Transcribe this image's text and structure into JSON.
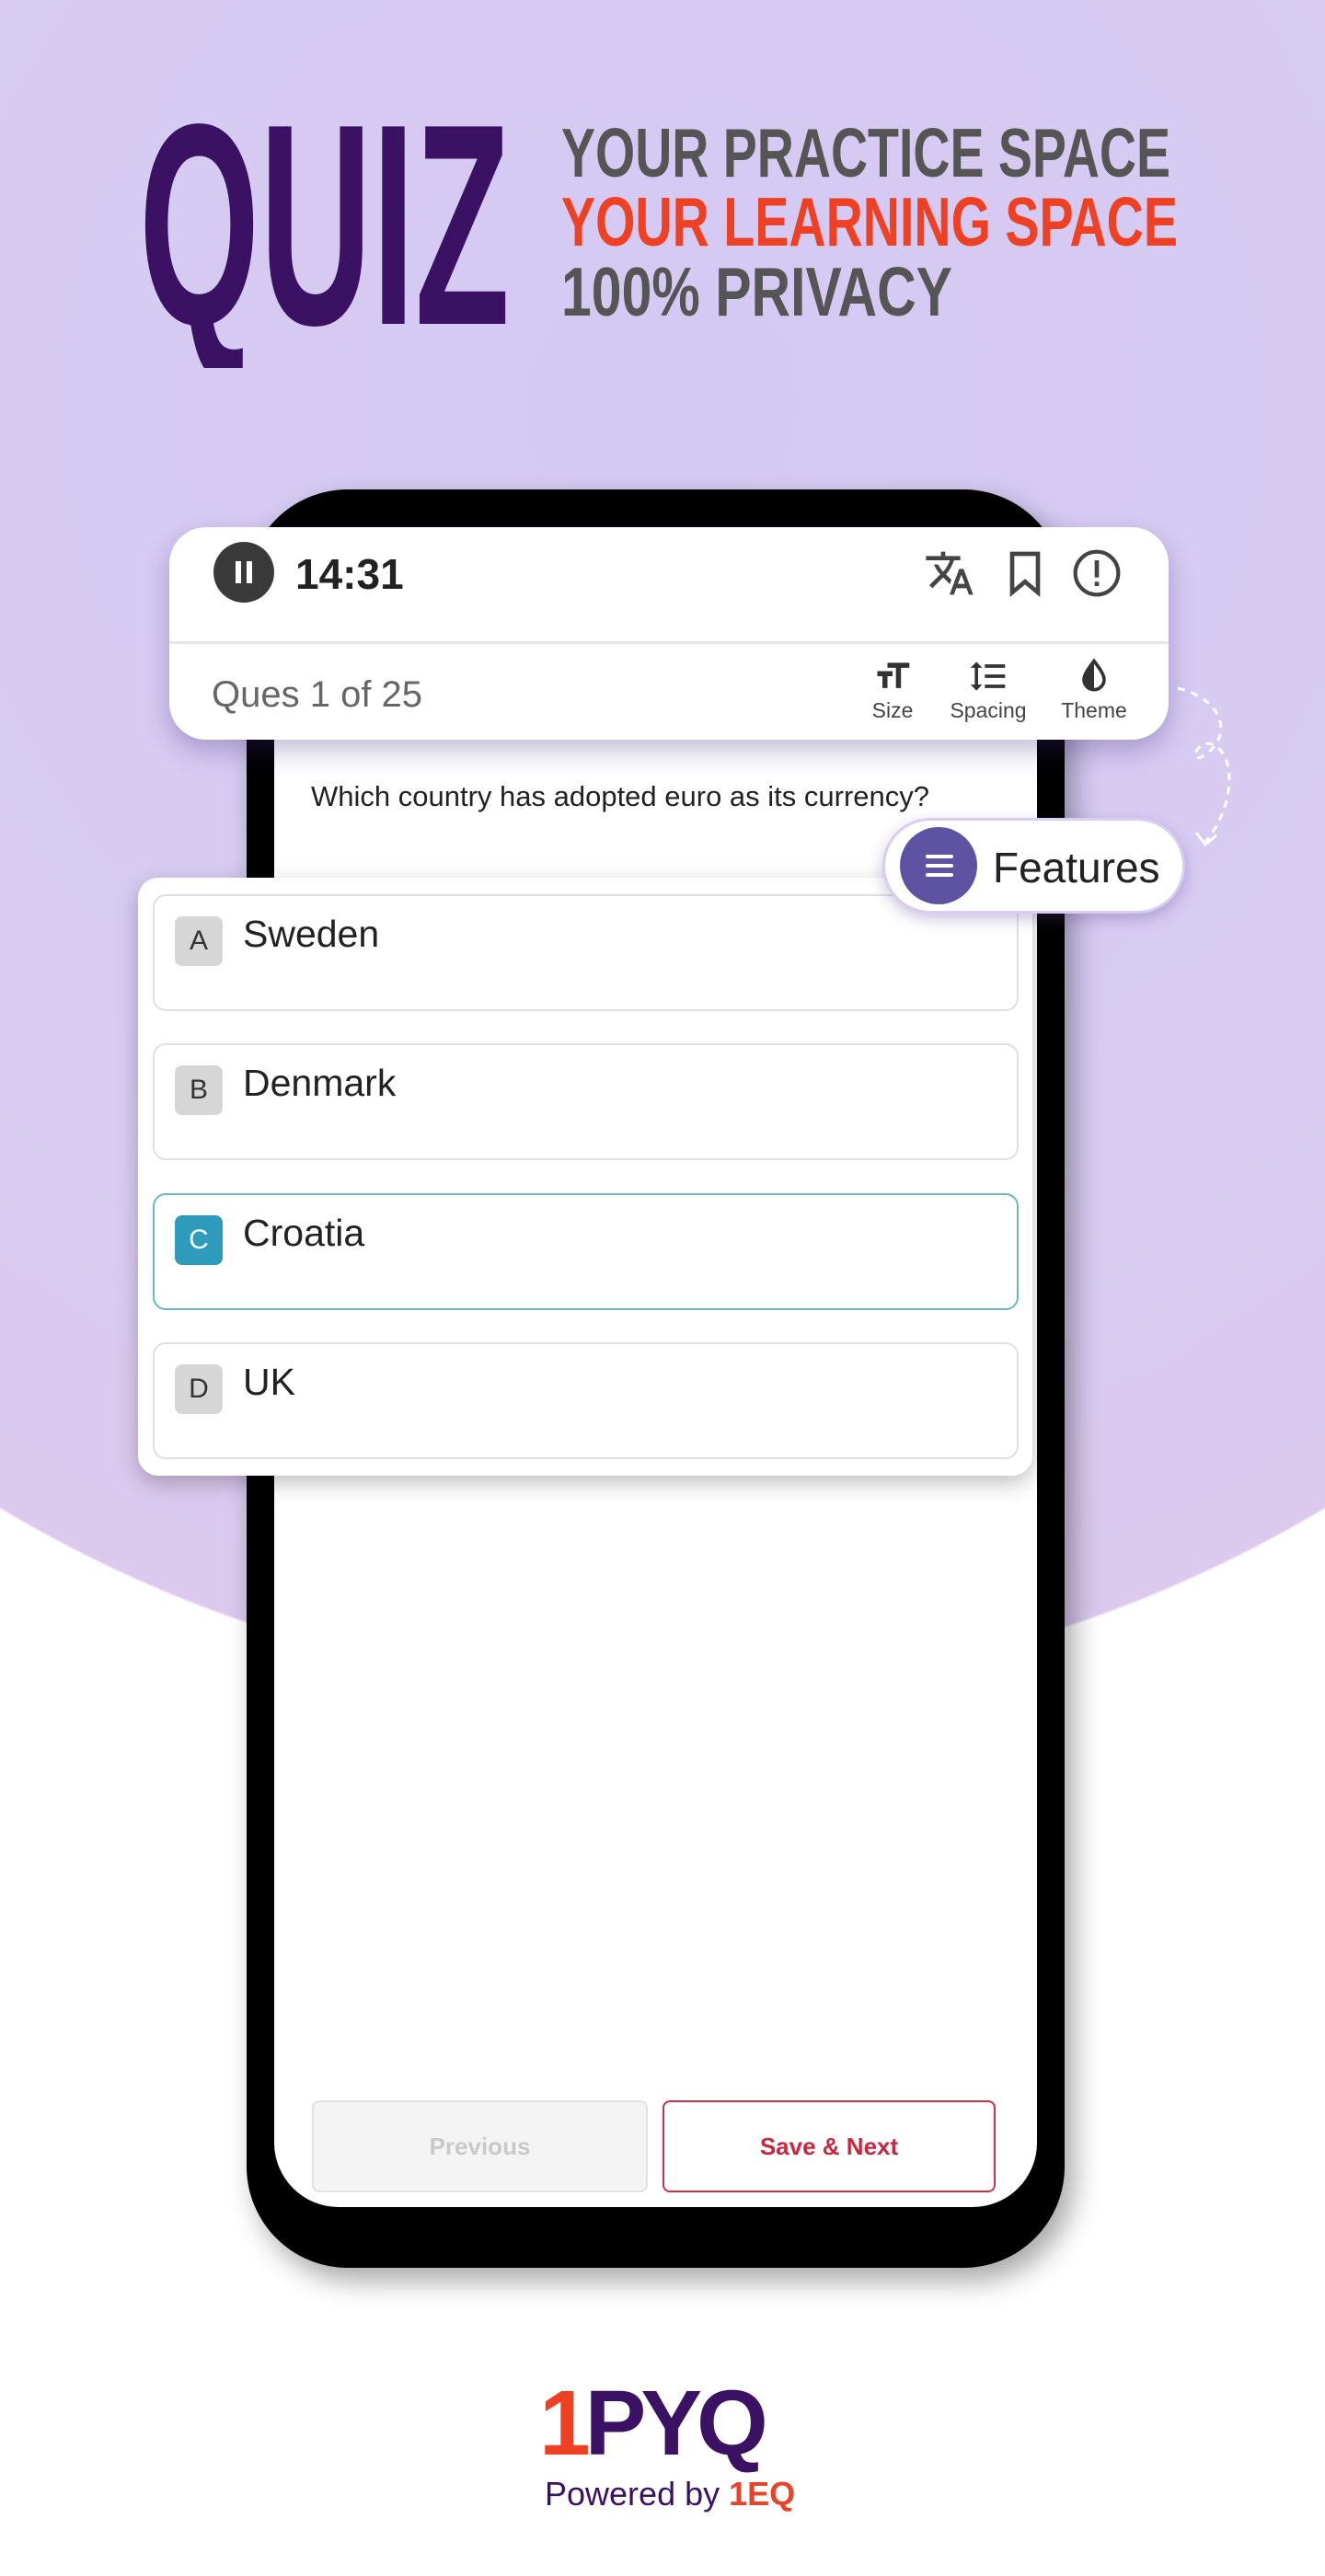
{
  "hero": {
    "title": "QUIZ",
    "taglines": [
      "YOUR PRACTICE SPACE",
      "YOUR LEARNING SPACE",
      "100% PRIVACY"
    ],
    "colors": {
      "title": "#3b1163",
      "tagline": "#555555",
      "accent": "#ee4123",
      "background": "#d4c9f3"
    }
  },
  "quiz_header": {
    "timer": "14:31",
    "icons": [
      "pause-icon",
      "translate-icon",
      "bookmark-icon",
      "report-icon"
    ],
    "question_counter": "Ques 1 of 25",
    "tools": [
      {
        "label": "Size",
        "icon": "font-size-icon"
      },
      {
        "label": "Spacing",
        "icon": "line-spacing-icon"
      },
      {
        "label": "Theme",
        "icon": "theme-drop-icon"
      }
    ]
  },
  "question": {
    "text": "Which country has adopted euro as its currency?",
    "options": [
      {
        "letter": "A",
        "text": "Sweden",
        "selected": false
      },
      {
        "letter": "B",
        "text": "Denmark",
        "selected": false
      },
      {
        "letter": "C",
        "text": "Croatia",
        "selected": true
      },
      {
        "letter": "D",
        "text": "UK",
        "selected": false
      }
    ]
  },
  "features_button": {
    "label": "Features",
    "icon": "menu-icon",
    "color": "#5e52a3"
  },
  "footer_buttons": {
    "previous": "Previous",
    "save_next": "Save & Next"
  },
  "brand": {
    "logo": "1PYQ",
    "logo_parts": [
      "1",
      "PYQ"
    ],
    "powered_by": "Powered by",
    "powered_brand": "1EQ"
  }
}
